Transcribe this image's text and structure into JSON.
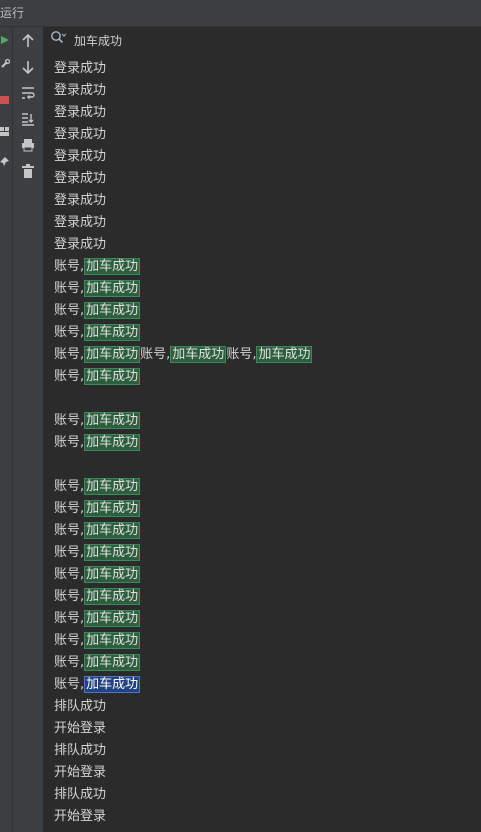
{
  "window": {
    "title": "运行"
  },
  "search": {
    "value": "加车成功",
    "placeholder": ""
  },
  "toolbar": {
    "buttons": [
      {
        "name": "up-arrow-icon"
      },
      {
        "name": "down-arrow-icon"
      },
      {
        "name": "soft-wrap-icon"
      },
      {
        "name": "scroll-to-end-icon"
      },
      {
        "name": "print-icon"
      },
      {
        "name": "trash-icon"
      }
    ]
  },
  "console": {
    "lines": [
      {
        "parts": [
          {
            "t": "登录成功"
          }
        ]
      },
      {
        "parts": [
          {
            "t": "登录成功"
          }
        ]
      },
      {
        "parts": [
          {
            "t": "登录成功"
          }
        ]
      },
      {
        "parts": [
          {
            "t": "登录成功"
          }
        ]
      },
      {
        "parts": [
          {
            "t": "登录成功"
          }
        ]
      },
      {
        "parts": [
          {
            "t": "登录成功"
          }
        ]
      },
      {
        "parts": [
          {
            "t": "登录成功"
          }
        ]
      },
      {
        "parts": [
          {
            "t": "登录成功"
          }
        ]
      },
      {
        "parts": [
          {
            "t": "登录成功"
          }
        ]
      },
      {
        "parts": [
          {
            "t": "账号,"
          },
          {
            "t": "加车成功",
            "hl": true
          }
        ]
      },
      {
        "parts": [
          {
            "t": "账号,"
          },
          {
            "t": "加车成功",
            "hl": true
          }
        ]
      },
      {
        "parts": [
          {
            "t": "账号,"
          },
          {
            "t": "加车成功",
            "hl": true
          }
        ]
      },
      {
        "parts": [
          {
            "t": "账号,"
          },
          {
            "t": "加车成功",
            "hl": true
          }
        ]
      },
      {
        "parts": [
          {
            "t": "账号,"
          },
          {
            "t": "加车成功",
            "hl": true
          },
          {
            "t": "账号,"
          },
          {
            "t": "加车成功",
            "hl": true
          },
          {
            "t": "账号,"
          },
          {
            "t": "加车成功",
            "hl": true
          }
        ]
      },
      {
        "parts": [
          {
            "t": "账号,"
          },
          {
            "t": "加车成功",
            "hl": true
          }
        ]
      },
      {
        "parts": []
      },
      {
        "parts": [
          {
            "t": "账号,"
          },
          {
            "t": "加车成功",
            "hl": true
          }
        ]
      },
      {
        "parts": [
          {
            "t": "账号,"
          },
          {
            "t": "加车成功",
            "hl": true
          }
        ]
      },
      {
        "parts": []
      },
      {
        "parts": [
          {
            "t": "账号,"
          },
          {
            "t": "加车成功",
            "hl": true
          }
        ]
      },
      {
        "parts": [
          {
            "t": "账号,"
          },
          {
            "t": "加车成功",
            "hl": true
          }
        ]
      },
      {
        "parts": [
          {
            "t": "账号,"
          },
          {
            "t": "加车成功",
            "hl": true
          }
        ]
      },
      {
        "parts": [
          {
            "t": "账号,"
          },
          {
            "t": "加车成功",
            "hl": true
          }
        ]
      },
      {
        "parts": [
          {
            "t": "账号,"
          },
          {
            "t": "加车成功",
            "hl": true
          }
        ]
      },
      {
        "parts": [
          {
            "t": "账号,"
          },
          {
            "t": "加车成功",
            "hl": true
          }
        ]
      },
      {
        "parts": [
          {
            "t": "账号,"
          },
          {
            "t": "加车成功",
            "hl": true
          }
        ]
      },
      {
        "parts": [
          {
            "t": "账号,"
          },
          {
            "t": "加车成功",
            "hl": true
          }
        ]
      },
      {
        "parts": [
          {
            "t": "账号,"
          },
          {
            "t": "加车成功",
            "hl": true
          }
        ]
      },
      {
        "parts": [
          {
            "t": "账号,"
          },
          {
            "t": "加车成功",
            "hl": true,
            "active": true
          }
        ]
      },
      {
        "parts": [
          {
            "t": "排队成功"
          }
        ]
      },
      {
        "parts": [
          {
            "t": "开始登录"
          }
        ]
      },
      {
        "parts": [
          {
            "t": "排队成功"
          }
        ]
      },
      {
        "parts": [
          {
            "t": "开始登录"
          }
        ]
      },
      {
        "parts": [
          {
            "t": "排队成功"
          }
        ]
      },
      {
        "parts": [
          {
            "t": "开始登录"
          }
        ]
      }
    ]
  },
  "colors": {
    "background": "#2b2b2b",
    "panel": "#3c3f41",
    "text": "#d4d4d4",
    "match_highlight": "#2d5f3f",
    "current_match_highlight": "#214283"
  }
}
